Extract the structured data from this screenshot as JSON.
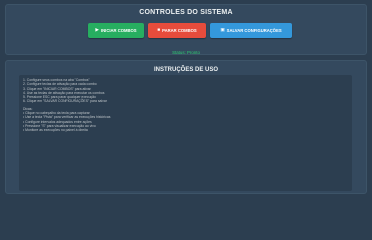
{
  "controls": {
    "title": "CONTROLES DO SISTEMA",
    "start_label": "INICIAR COMBOS",
    "start_icon": "play-icon",
    "stop_label": "PARAR COMBOS",
    "stop_icon": "stop-icon",
    "save_label": "SALVAR CONFIGURAÇÕES",
    "save_icon": "save-icon",
    "status": "Status: Pronto"
  },
  "instructions": {
    "title": "INSTRUÇÕES DE USO",
    "steps": [
      "1. Configure seus combos na aba \"Combos\"",
      "2. Configure teclas de ativação para cada combo",
      "3. Clique em \"INICIAR COMBOS\" para ativar",
      "4. Use as teclas de ativação para executar os combos",
      "5. Pressione ESC para parar qualquer execução",
      "6. Clique em \"SALVAR CONFIGURAÇÕES\" para salvar"
    ],
    "tips_title": "Dicas:",
    "tips": [
      "• Clique no cabeçalho da tecla para capturar",
      "• Use a tecla \"Pista\" para verificar as execuções históricas",
      "• Configure intervalos adequados entre ações",
      "• Pressione \"S\" para visualizar execução ao vivo",
      "• Monitore as execuções no painel à direita"
    ]
  },
  "colors": {
    "background": "#2c3e50",
    "panel": "#34495e",
    "start_button": "#27ae60",
    "stop_button": "#e74c3c",
    "save_button": "#3498db",
    "status_text": "#2ecc71"
  }
}
